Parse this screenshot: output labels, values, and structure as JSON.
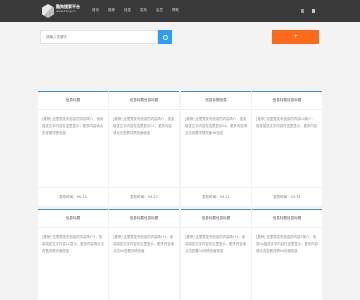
{
  "header": {
    "brand_name": "酷狗搜索平台",
    "brand_url": "www.kbug.cc",
    "nav": [
      "首页",
      "推荐",
      "信息",
      "发布",
      "会员",
      "帮助"
    ]
  },
  "search": {
    "placeholder": "请输入关键字",
    "add_label": "+"
  },
  "cards": [
    {
      "title": "信息标题",
      "body": "[推荐] 这里是发布信息的内容简介，信息描述文字内容在这里显示，更多内容请点击查看详情页面",
      "footer": "发布时间：05-14"
    },
    {
      "title": "信息标题信息标题",
      "body": "[推荐] 这里是发布信息的内容简介，信息描述文字内容在这里显示C1，更多内容请点击查看详情页面信息",
      "footer": "发布时间：04-27"
    },
    {
      "title": "信息标题信息",
      "body": "[推荐] 这里是发布信息的内容简介，信息描述文字内容在这里显示04，更多内容请点击查看详情页面36信息",
      "footer": "发布时间：04-21"
    },
    {
      "title": "信息标题信息标题",
      "body": "[推荐] 这里是发布信息的内容04简介，信息描述文字内容在这里显示，更多内容",
      "footer": "发布时间：03-31"
    },
    {
      "title": "信息标题",
      "body": "[推荐] 这里是发布信息的内容简介5，信息描述文字内容12显示，更多内容请点击查看详情页面信息",
      "footer": ""
    },
    {
      "title": "信息标题信息标题",
      "body": "[推荐] 这里是发布信息的内容简介5，信息描述文字内容在这里显示，更多内容请点击04查看详情页面",
      "footer": ""
    },
    {
      "title": "信息标题信息标题",
      "body": "[推荐] 这里是发布信息的内容简介5，信息描述文字内容在这里显示，更多内容请点击查看04详情页面信息",
      "footer": ""
    },
    {
      "title": "信息标题信息标题",
      "body": "[推荐] 这里是发布信息的内容5简介，信息04描述文字内容在这里显示，更多内容请点击查看详情04页面信息",
      "footer": ""
    }
  ]
}
